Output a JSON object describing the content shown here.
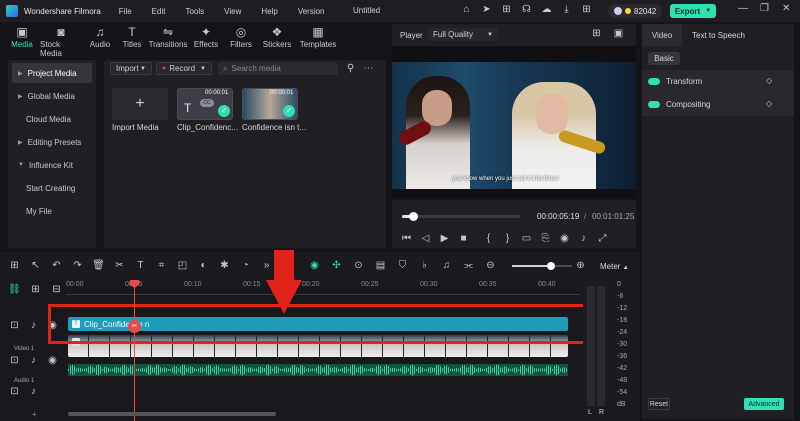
{
  "titlebar": {
    "app": "Wondershare Filmora",
    "menu": [
      "File",
      "Edit",
      "Tools",
      "View",
      "Help",
      "Version"
    ],
    "doc_title": "Untitled",
    "credits": "82042",
    "export": "Export"
  },
  "media_tabs": [
    {
      "label": "Media",
      "icon": "media-icon"
    },
    {
      "label": "Stock Media",
      "icon": "stock-media-icon"
    },
    {
      "label": "Audio",
      "icon": "audio-icon"
    },
    {
      "label": "Titles",
      "icon": "titles-icon"
    },
    {
      "label": "Transitions",
      "icon": "transitions-icon"
    },
    {
      "label": "Effects",
      "icon": "effects-icon"
    },
    {
      "label": "Filters",
      "icon": "filters-icon"
    },
    {
      "label": "Stickers",
      "icon": "stickers-icon"
    },
    {
      "label": "Templates",
      "icon": "templates-icon"
    }
  ],
  "sidebar": [
    {
      "label": "Project Media",
      "active": true,
      "caret": true
    },
    {
      "label": "Global Media",
      "caret": true
    },
    {
      "label": "Cloud Media"
    },
    {
      "label": "Editing Presets",
      "caret": true
    },
    {
      "label": "Influence Kit",
      "caret": true
    },
    {
      "label": "Start Creating",
      "sub": true
    },
    {
      "label": "My File",
      "sub": true
    }
  ],
  "media": {
    "import_dd": "Import",
    "record_dd": "Record",
    "search_placeholder": "Search media",
    "import_label": "Import Media",
    "clips": [
      {
        "name": "Clip_Confidenc...",
        "duration": "00:00:01"
      },
      {
        "name": "Confidence isn t...",
        "duration": "00:00:01"
      }
    ]
  },
  "player": {
    "label": "Player",
    "quality": "Full Quality",
    "subtitle": "you know when you just call it into those",
    "current_time": "00:00:05:19",
    "total_time": "00:01:01:25"
  },
  "right_panel": {
    "tabs": [
      "Video",
      "Text to Speech"
    ],
    "basic": "Basic",
    "items": [
      "Transform",
      "Compositing"
    ],
    "reset": "Reset",
    "advanced": "Advanced"
  },
  "timeline": {
    "meter_label": "Meter",
    "ruler": [
      "00:00",
      "00:05",
      "00:10",
      "00:15",
      "00:20",
      "00:25",
      "00:30",
      "00:35",
      "00:40"
    ],
    "clip_label": "Clip_Confidence n",
    "video_track": "Video 1",
    "audio_track": "Audio 1",
    "meter_ticks": [
      "0",
      "-6",
      "-12",
      "-18",
      "-24",
      "-30",
      "-36",
      "-42",
      "-48",
      "-54",
      "dB"
    ],
    "meter_lr": [
      "L",
      "R"
    ],
    "playhead_time": "00:00:05:19",
    "zoom_level": 0.65,
    "progress": 0.09
  },
  "annotation": {
    "color": "#e2231a"
  }
}
